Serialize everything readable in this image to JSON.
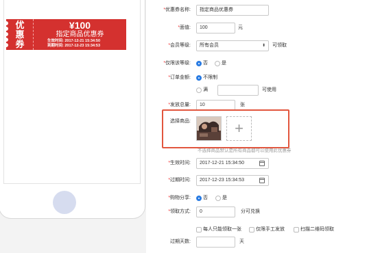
{
  "coupon_preview": {
    "badge_chars": [
      "优",
      "惠",
      "券"
    ],
    "amount": "¥100",
    "name": "指定商品优惠券",
    "effective": "生效时间: 2017-12-21 15:34:50",
    "expiry": "到期时间: 2017-12-23 15:34:53",
    "color": "#d4312f"
  },
  "form": {
    "name": {
      "label": "优惠券名称:",
      "value": "指定商品优惠券"
    },
    "face": {
      "label": "面值:",
      "value": "100",
      "unit": "元"
    },
    "level": {
      "label": "会员等级:",
      "value": "所有会员",
      "suffix": "可领取"
    },
    "only_level": {
      "label": "仅限该等级:",
      "options": [
        "否",
        "是"
      ],
      "selected": "否"
    },
    "order_amount": {
      "label": "订单金额:",
      "option_unlimited": "不限制",
      "option_full": "满",
      "full_value": "",
      "suffix": "可使用"
    },
    "total": {
      "label": "发放总量:",
      "value": "10",
      "unit": "张"
    },
    "goods": {
      "label": "选择商品:",
      "add": "+",
      "hint": "不选择商品默认是所有商品都可以使用此优惠券"
    },
    "start": {
      "label": "生效时间:",
      "value": "2017-12-21 15:34:50"
    },
    "end": {
      "label": "过期时间:",
      "value": "2017-12-23 15:34:53"
    },
    "share": {
      "label": "购物分享:",
      "options": [
        "否",
        "是"
      ],
      "selected": "否"
    },
    "claim": {
      "label": "领取方式:",
      "value": "0",
      "suffix": "分可兑换",
      "options": [
        "每人只能领取一张",
        "仅限手工发放",
        "扫描二维码领取"
      ]
    },
    "expire_days": {
      "label": "过期天数:",
      "value": "",
      "unit": "天"
    }
  }
}
